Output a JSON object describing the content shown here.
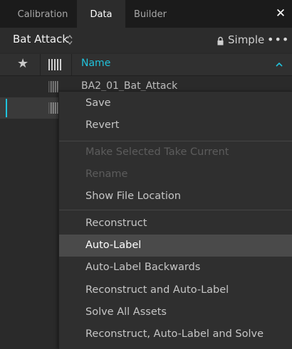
{
  "tabs": [
    {
      "label": "Calibration"
    },
    {
      "label": "Data"
    },
    {
      "label": "Builder"
    }
  ],
  "active_tab": "Data",
  "close_label": "✕",
  "title": {
    "take_name": "Bat Attack",
    "mode": "Simple",
    "more": "•••"
  },
  "columns": {
    "star": "★",
    "name": "Name"
  },
  "rows": [
    {
      "name": "BA2_01_Bat_Attack"
    },
    {
      "name": ""
    }
  ],
  "menu": {
    "items": [
      {
        "label": "Save",
        "enabled": true
      },
      {
        "label": "Revert",
        "enabled": true
      },
      {
        "label": "Make Selected Take Current",
        "enabled": false
      },
      {
        "label": "Rename",
        "enabled": false
      },
      {
        "label": "Show File Location",
        "enabled": true
      },
      {
        "label": "Reconstruct",
        "enabled": true
      },
      {
        "label": "Auto-Label",
        "enabled": true,
        "hovered": true
      },
      {
        "label": "Auto-Label Backwards",
        "enabled": true
      },
      {
        "label": "Reconstruct and Auto-Label",
        "enabled": true
      },
      {
        "label": "Solve All Assets",
        "enabled": true
      },
      {
        "label": "Reconstruct, Auto-Label and Solve",
        "enabled": true
      }
    ]
  },
  "colors": {
    "accent": "#1fc4de",
    "background": "#2a2a2a",
    "menu_bg": "#2f2f2f",
    "menu_hover": "#4a4a4a",
    "disabled_text": "#5c5c5c"
  }
}
